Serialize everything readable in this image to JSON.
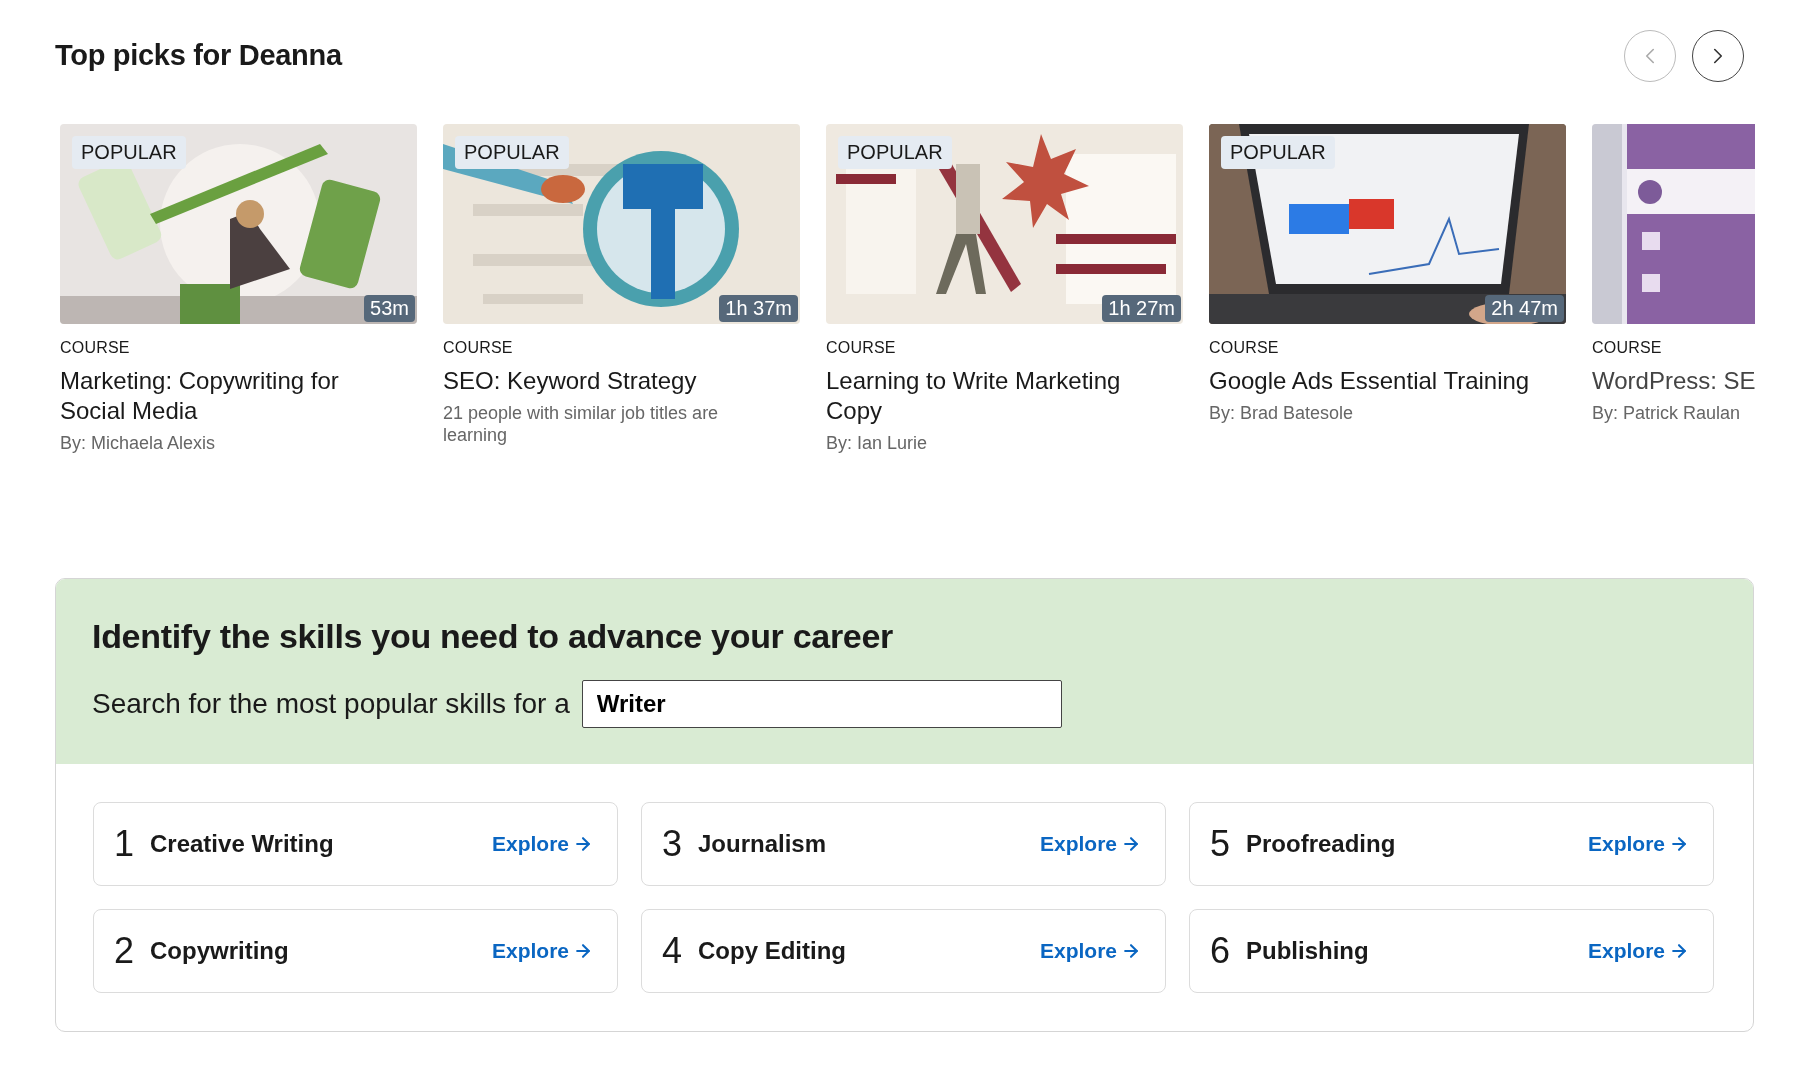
{
  "section_title": "Top picks for Deanna",
  "carousel_nav": {
    "previous": {
      "disabled": true
    },
    "next": {
      "disabled": false
    }
  },
  "courses": [
    {
      "badge": "POPULAR",
      "duration": "53m",
      "type": "COURSE",
      "title": "Marketing: Copywriting for Social Media",
      "subtitle": "By: Michaela Alexis"
    },
    {
      "badge": "POPULAR",
      "duration": "1h 37m",
      "type": "COURSE",
      "title": "SEO: Keyword Strategy",
      "subtitle": "21 people with similar job titles are learning"
    },
    {
      "badge": "POPULAR",
      "duration": "1h 27m",
      "type": "COURSE",
      "title": "Learning to Write Marketing Copy",
      "subtitle": "By: Ian Lurie"
    },
    {
      "badge": "POPULAR",
      "duration": "2h 47m",
      "type": "COURSE",
      "title": "Google Ads Essential Training",
      "subtitle": "By: Brad Batesole"
    },
    {
      "type": "COURSE",
      "title": "WordPress: SE",
      "subtitle": "By: Patrick Raulan"
    }
  ],
  "skills_panel": {
    "heading": "Identify the skills you need to advance your career",
    "search_label": "Search for the most popular skills for a",
    "search_value": "Writer",
    "skills": [
      {
        "rank": "1",
        "name": "Creative Writing",
        "link": "Explore"
      },
      {
        "rank": "2",
        "name": "Copywriting",
        "link": "Explore"
      },
      {
        "rank": "3",
        "name": "Journalism",
        "link": "Explore"
      },
      {
        "rank": "4",
        "name": "Copy Editing",
        "link": "Explore"
      },
      {
        "rank": "5",
        "name": "Proofreading",
        "link": "Explore"
      },
      {
        "rank": "6",
        "name": "Publishing",
        "link": "Explore"
      }
    ]
  }
}
